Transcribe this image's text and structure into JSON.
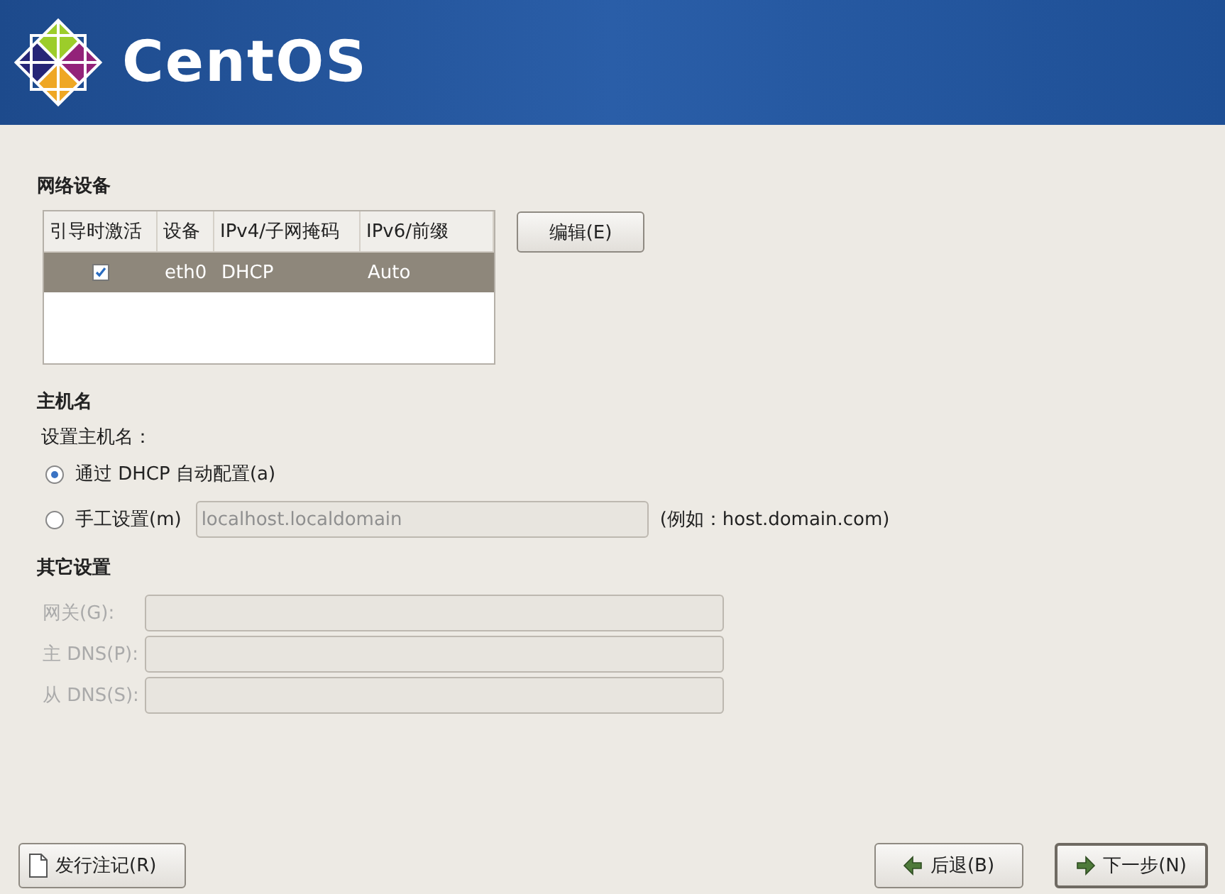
{
  "header": {
    "logo_text": "CentOS"
  },
  "network_devices": {
    "title": "网络设备",
    "columns": [
      "引导时激活",
      "设备",
      "IPv4/子网掩码",
      "IPv6/前缀"
    ],
    "rows": [
      {
        "checked": true,
        "device": "eth0",
        "ipv4": "DHCP",
        "ipv6": "Auto",
        "selected": true
      }
    ],
    "edit_button": "编辑(E)"
  },
  "hostname": {
    "title": "主机名",
    "label": "设置主机名：",
    "options": [
      {
        "label": "通过 DHCP 自动配置(a)",
        "selected": true
      },
      {
        "label": "手工设置(m)",
        "selected": false,
        "field": {
          "value": "localhost.localdomain",
          "disabled": true
        },
        "hint": "(例如：host.domain.com)"
      }
    ]
  },
  "other_settings": {
    "title": "其它设置",
    "fields": [
      {
        "label": "网关(G):",
        "disabled": true
      },
      {
        "label": "主 DNS(P):",
        "disabled": true
      },
      {
        "label": "从 DNS(S):",
        "disabled": true
      }
    ]
  },
  "buttons": {
    "release_notes": "发行注记(R)",
    "back": "后退(B)",
    "next": "下一步(N)"
  }
}
